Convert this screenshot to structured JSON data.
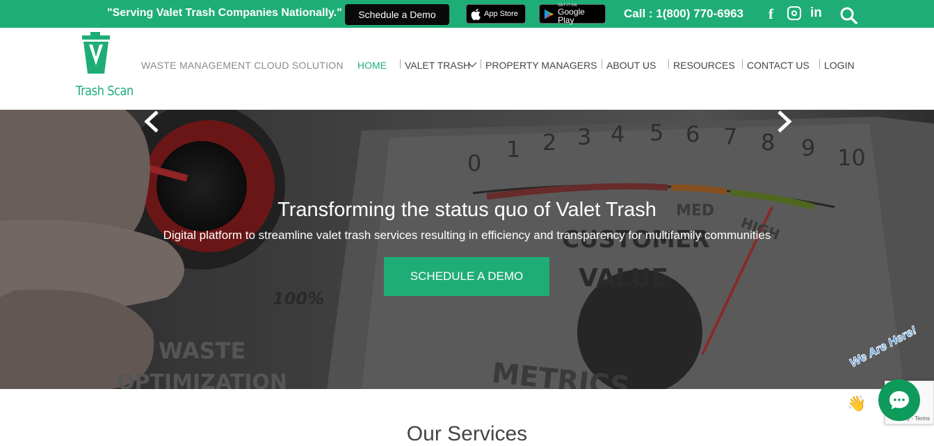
{
  "topbar": {
    "tagline": "\"Serving Valet Trash Companies Nationally.\"",
    "demo_label": "Schedule a Demo",
    "app_store_label": "App Store",
    "google_play_small": "GET IT ON",
    "google_play_label": "Google Play",
    "call_text": "Call : 1(800) 770-6963",
    "social_icons": [
      "facebook-icon",
      "instagram-icon",
      "linkedin-icon"
    ],
    "facebook_glyph": "f",
    "linkedin_glyph": "in"
  },
  "header": {
    "logo_text": "Trash Scan",
    "slogan": "WASTE MANAGEMENT CLOUD SOLUTION",
    "nav": [
      "HOME",
      "VALET TRASH",
      "PROPERTY MANAGERS",
      "ABOUT US",
      "RESOURCES",
      "CONTACT US",
      "LOGIN"
    ],
    "active_nav": "HOME"
  },
  "hero": {
    "title": "Transforming the status quo of Valet Trash",
    "subtitle": "Digital platform to streamline valet trash services resulting in efficiency and transparency for multifamily communities",
    "button_label": "SCHEDULE A DEMO",
    "gauge_text": {
      "med": "MED",
      "high": "HIGH",
      "customer": "CUSTOMER",
      "value": "VALUE",
      "metrics": "METRICS",
      "waste": "WASTE",
      "optimization": "OPTIMIZATION",
      "percent": "100%",
      "scale": [
        "0",
        "1",
        "2",
        "3",
        "4",
        "5",
        "6",
        "7",
        "8",
        "9",
        "10"
      ]
    }
  },
  "services": {
    "title": "Our Services"
  },
  "chat": {
    "banner": "We Are Here!",
    "wave_glyph": "👋"
  },
  "recaptcha": {
    "text": "Privacy - Terms"
  },
  "colors": {
    "brand_green": "#1fad77",
    "topbar_black": "#0a0a0a",
    "chat_green": "#0e9a5b"
  }
}
